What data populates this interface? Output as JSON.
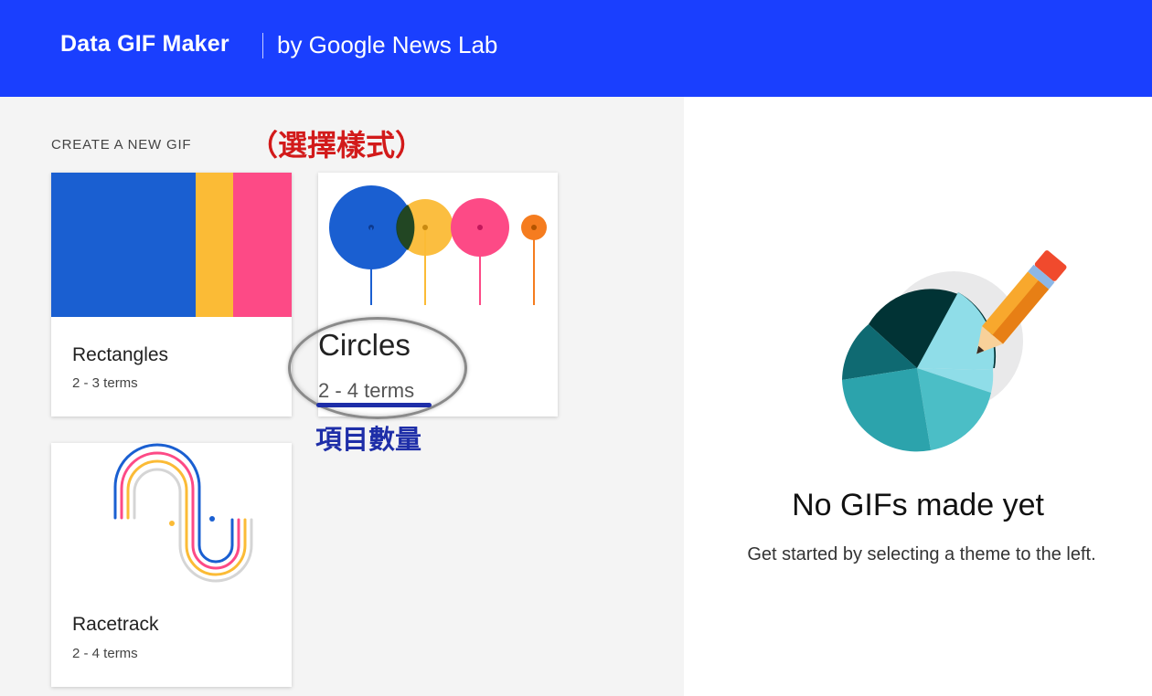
{
  "header": {
    "app_title": "Data GIF Maker",
    "byline": "by Google News Lab",
    "background": "#1a3ffe"
  },
  "section_label": "CREATE A NEW GIF",
  "annotations": {
    "select_style": "（選擇樣式）",
    "item_count": "項目數量",
    "red": "#d21a1a",
    "blue": "#1e2ea8"
  },
  "cards": [
    {
      "name": "Rectangles",
      "terms": "2 - 3 terms",
      "colors": [
        "#1a5fd1",
        "#fbbb36",
        "#fd4a86"
      ]
    },
    {
      "name": "Circles",
      "terms": "2 - 4 terms",
      "colors": [
        "#1a5fd1",
        "#fbbb36",
        "#fd4a86",
        "#f57c1f"
      ]
    },
    {
      "name": "Racetrack",
      "terms": "2 - 4 terms",
      "colors": [
        "#1a5fd1",
        "#fbbb36",
        "#fd4a86",
        "#d5d5d5"
      ]
    }
  ],
  "empty_state": {
    "icon": "pie-chart-pencil-icon",
    "title": "No GIFs made yet",
    "description": "Get started by selecting a theme to the left."
  }
}
